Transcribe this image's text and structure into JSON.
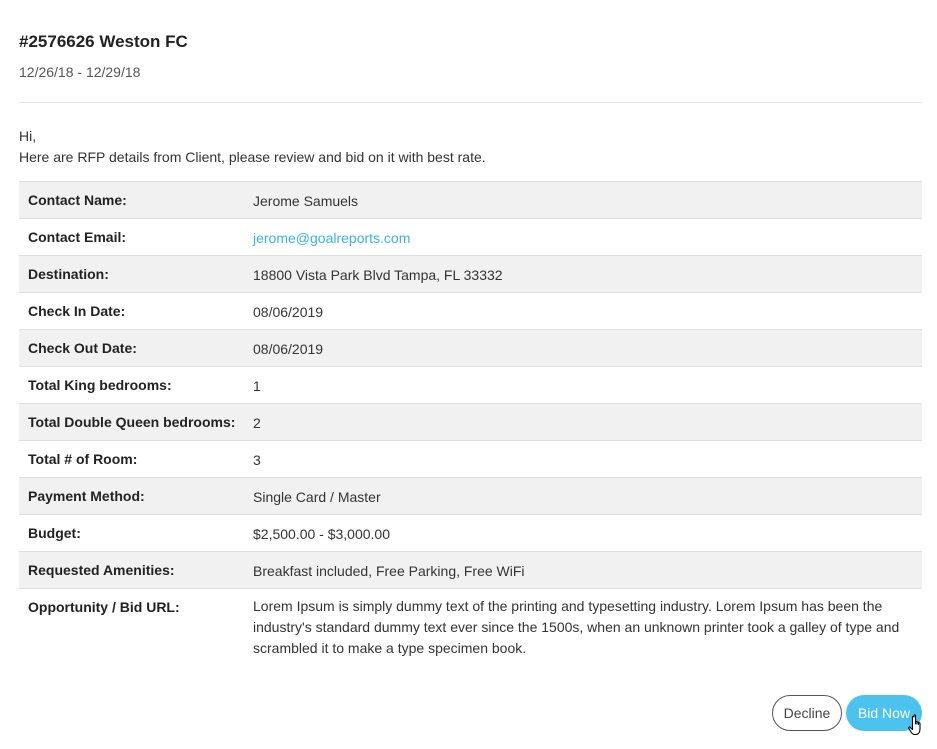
{
  "header": {
    "title": "#2576626 Weston FC",
    "dates": "12/26/18 - 12/29/18"
  },
  "message": {
    "greeting": "Hi,",
    "intro": "Here are RFP details from Client, please review and bid on it with best rate."
  },
  "details": [
    {
      "label": "Contact Name:",
      "value": "Jerome Samuels"
    },
    {
      "label": "Contact Email:",
      "value": "jerome@goalreports.com"
    },
    {
      "label": "Destination:",
      "value": "18800 Vista Park Blvd Tampa, FL 33332"
    },
    {
      "label": "Check In Date:",
      "value": "08/06/2019"
    },
    {
      "label": "Check Out Date:",
      "value": "08/06/2019"
    },
    {
      "label": "Total King bedrooms:",
      "value": "1"
    },
    {
      "label": "Total Double Queen bedrooms:",
      "value": "2"
    },
    {
      "label": "Total # of Room:",
      "value": "3"
    },
    {
      "label": "Payment Method:",
      "value": "Single Card / Master"
    },
    {
      "label": "Budget:",
      "value": "$2,500.00 - $3,000.00"
    },
    {
      "label": "Requested Amenities:",
      "value": "Breakfast included, Free Parking, Free WiFi"
    },
    {
      "label": "Opportunity / Bid URL:",
      "value": "Lorem Ipsum is simply dummy text of the printing and typesetting industry. Lorem Ipsum has been the industry's standard dummy text ever since the 1500s, when an unknown printer took a galley of type and scrambled it to make a type specimen book."
    }
  ],
  "actions": {
    "decline_label": "Decline",
    "bid_label": "Bid Now"
  },
  "colors": {
    "link": "#3ab3e3",
    "primary_button": "#4cc3ee",
    "row_alt": "#f1f1f1"
  },
  "icons": {
    "cursor": "hand-pointer-icon"
  }
}
